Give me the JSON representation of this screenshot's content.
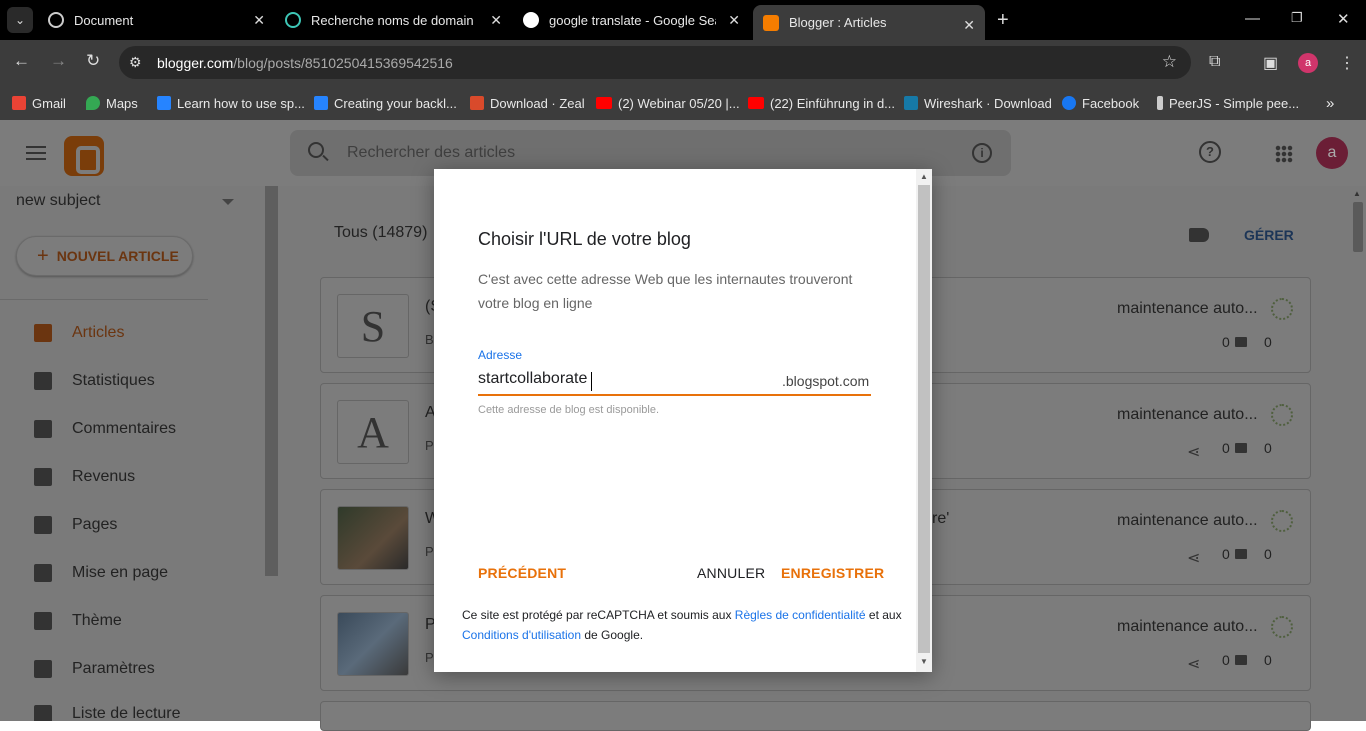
{
  "browser": {
    "tabs": [
      {
        "title": "Document",
        "icon": "globe-icon"
      },
      {
        "title": "Recherche noms de domaines G",
        "icon": "domain-icon"
      },
      {
        "title": "google translate - Google Searc",
        "icon": "google-icon"
      },
      {
        "title": "Blogger : Articles",
        "icon": "blogger-icon"
      }
    ],
    "url_domain": "blogger.com",
    "url_path": "/blog/posts/8510250415369542516",
    "profile_letter": "a",
    "bookmarks": [
      {
        "label": "Gmail",
        "icon": "gmail-icon",
        "color": "#ea4335"
      },
      {
        "label": "Maps",
        "icon": "maps-icon",
        "color": "#34a853"
      },
      {
        "label": "Learn how to use sp...",
        "icon": "atlassian-icon",
        "color": "#2684ff"
      },
      {
        "label": "Creating your backl...",
        "icon": "atlassian-icon",
        "color": "#2684ff"
      },
      {
        "label": "Download · Zeal",
        "icon": "zeal-icon",
        "color": "#d94a2b"
      },
      {
        "label": "(2) Webinar 05/20 |...",
        "icon": "youtube-icon",
        "color": "#ff0000"
      },
      {
        "label": "(22) Einführung in d...",
        "icon": "youtube-icon",
        "color": "#ff0000"
      },
      {
        "label": "Wireshark · Download",
        "icon": "wireshark-icon",
        "color": "#1679a7"
      },
      {
        "label": "Facebook",
        "icon": "facebook-icon",
        "color": "#1877f2"
      },
      {
        "label": "PeerJS - Simple pee...",
        "icon": "peerjs-icon",
        "color": "#cccccc"
      }
    ]
  },
  "blogger": {
    "search_placeholder": "Rechercher des articles",
    "profile_letter": "a",
    "blog_name": "new subject",
    "new_post_label": "NOUVEL ARTICLE",
    "nav": [
      {
        "label": "Articles",
        "icon": "articles-icon"
      },
      {
        "label": "Statistiques",
        "icon": "stats-icon"
      },
      {
        "label": "Commentaires",
        "icon": "comments-icon"
      },
      {
        "label": "Revenus",
        "icon": "dollar-icon"
      },
      {
        "label": "Pages",
        "icon": "pages-icon"
      },
      {
        "label": "Mise en page",
        "icon": "layout-icon"
      },
      {
        "label": "Thème",
        "icon": "theme-icon"
      },
      {
        "label": "Paramètres",
        "icon": "settings-icon"
      },
      {
        "label": "Liste de lecture",
        "icon": "reading-list-icon"
      }
    ],
    "all_label": "Tous (14879)",
    "manage_label": "GÉRER",
    "posts": [
      {
        "thumb": "S",
        "title": "(S",
        "sub": "Br",
        "author": "maintenance auto...",
        "comments": "0",
        "views": "0"
      },
      {
        "thumb": "A",
        "title": "A",
        "sub": "P",
        "author": "maintenance auto...",
        "comments": "0",
        "views": "0"
      },
      {
        "thumb": "",
        "title": "W",
        "title_tail": "re'",
        "sub": "P",
        "author": "maintenance auto...",
        "comments": "0",
        "views": "0"
      },
      {
        "thumb": "",
        "title": "P",
        "sub": "P",
        "author": "maintenance auto...",
        "comments": "0",
        "views": "0"
      }
    ]
  },
  "dialog": {
    "title": "Choisir l'URL de votre blog",
    "description": "C'est avec cette adresse Web que les internautes trouveront votre blog en ligne",
    "address_label": "Adresse",
    "address_value": "startcollaborate",
    "address_suffix": ".blogspot.com",
    "address_help": "Cette adresse de blog est disponible.",
    "prev_label": "PRÉCÉDENT",
    "cancel_label": "ANNULER",
    "save_label": "ENREGISTRER",
    "recaptcha_prefix": "Ce site est protégé par reCAPTCHA et soumis aux ",
    "privacy_link": "Règles de confidentialité",
    "recaptcha_middle": " et aux ",
    "terms_link": "Conditions d'utilisation",
    "recaptcha_suffix": " de Google.",
    "accent_color": "#e8710a"
  }
}
